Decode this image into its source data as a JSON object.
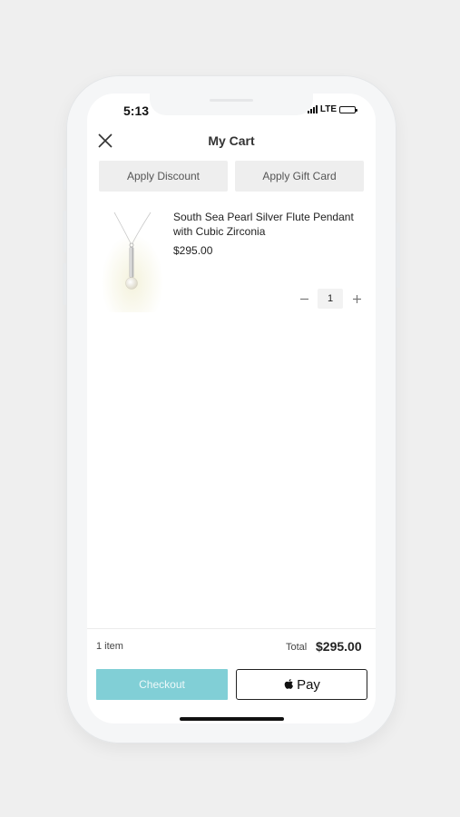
{
  "status_bar": {
    "time": "5:13",
    "network": "LTE"
  },
  "header": {
    "title": "My Cart"
  },
  "actions": {
    "apply_discount": "Apply Discount",
    "apply_gift_card": "Apply Gift Card"
  },
  "cart": {
    "items": [
      {
        "name": "South Sea Pearl Silver Flute Pendant with Cubic Zirconia",
        "price": "$295.00",
        "quantity": "1"
      }
    ]
  },
  "summary": {
    "item_count": "1 item",
    "total_label": "Total",
    "total_value": "$295.00"
  },
  "buttons": {
    "checkout": "Checkout",
    "apple_pay": "Pay"
  },
  "colors": {
    "checkout_bg": "#81cfd6"
  }
}
